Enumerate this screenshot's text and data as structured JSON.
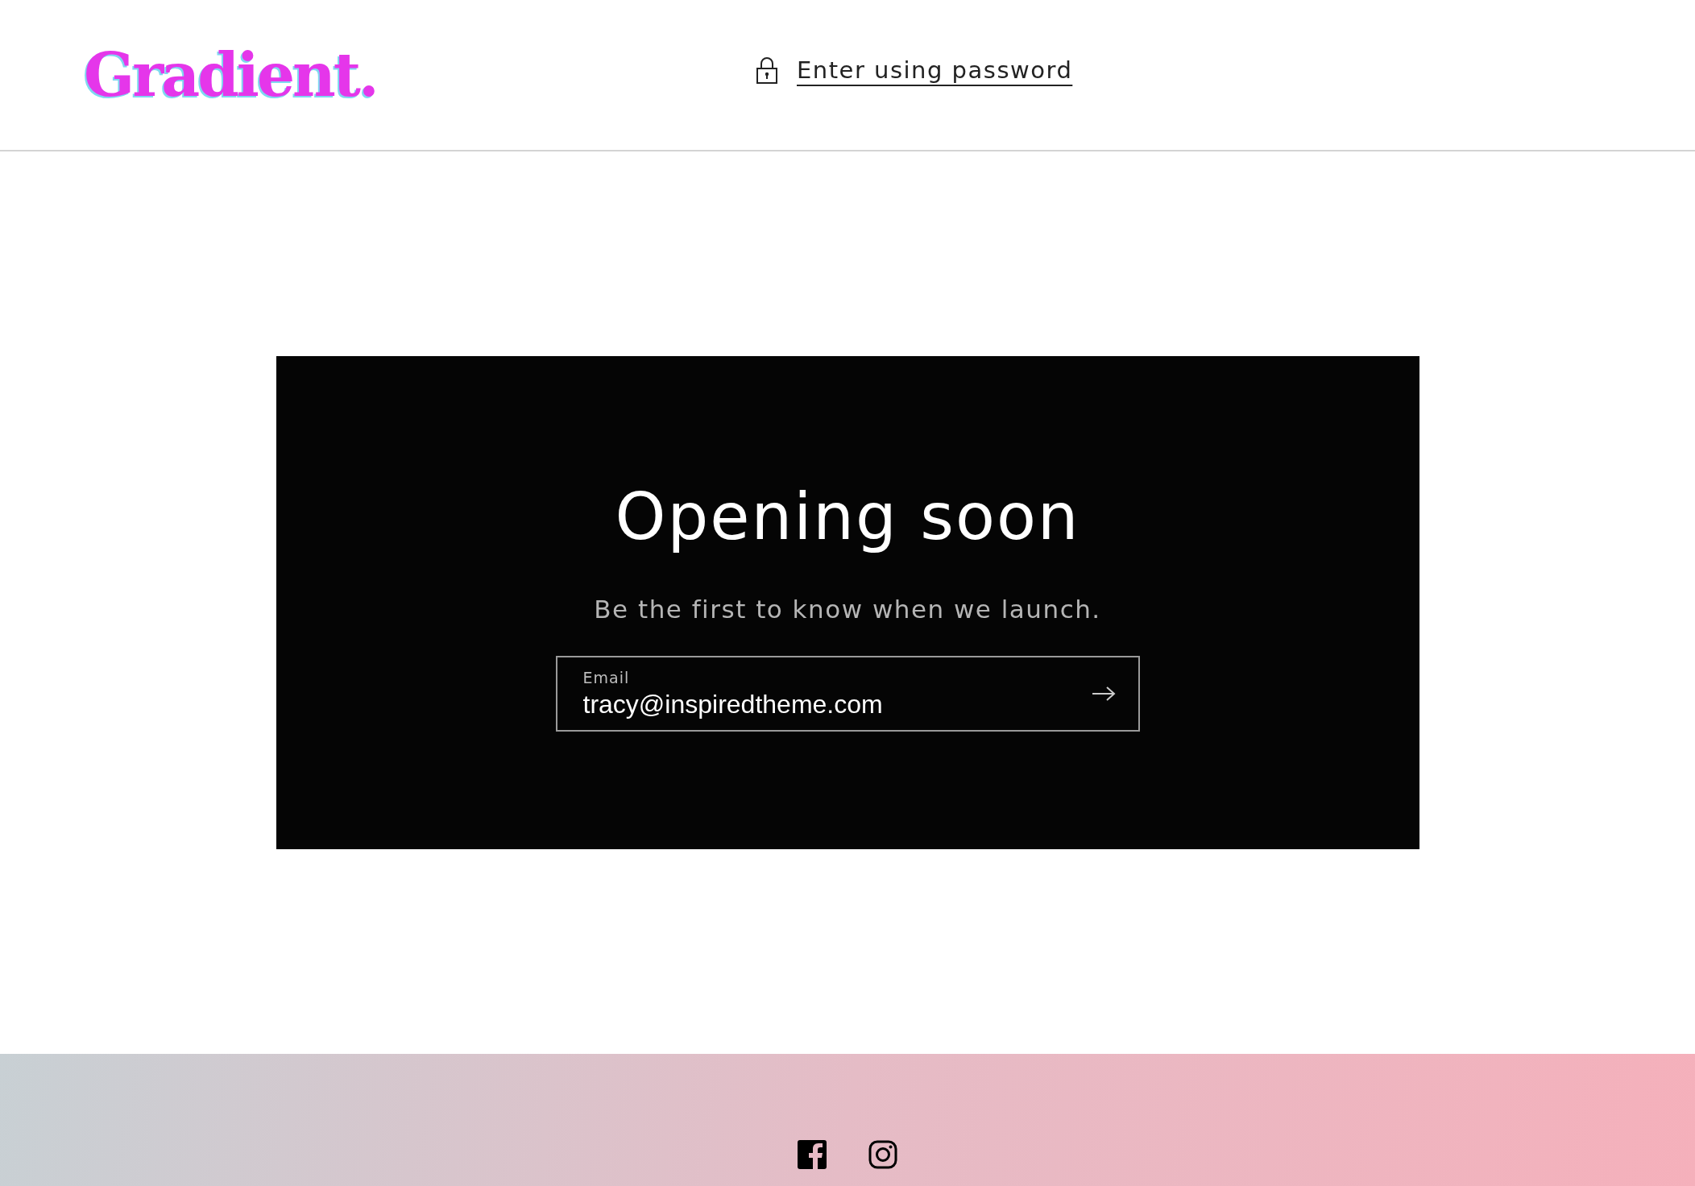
{
  "header": {
    "logo": "Gradient.",
    "password_link": "Enter using password"
  },
  "hero": {
    "title": "Opening soon",
    "subtitle": "Be the first to know when we launch.",
    "email_field": {
      "label": "Email",
      "value": "tracy@inspiredtheme.com"
    }
  }
}
